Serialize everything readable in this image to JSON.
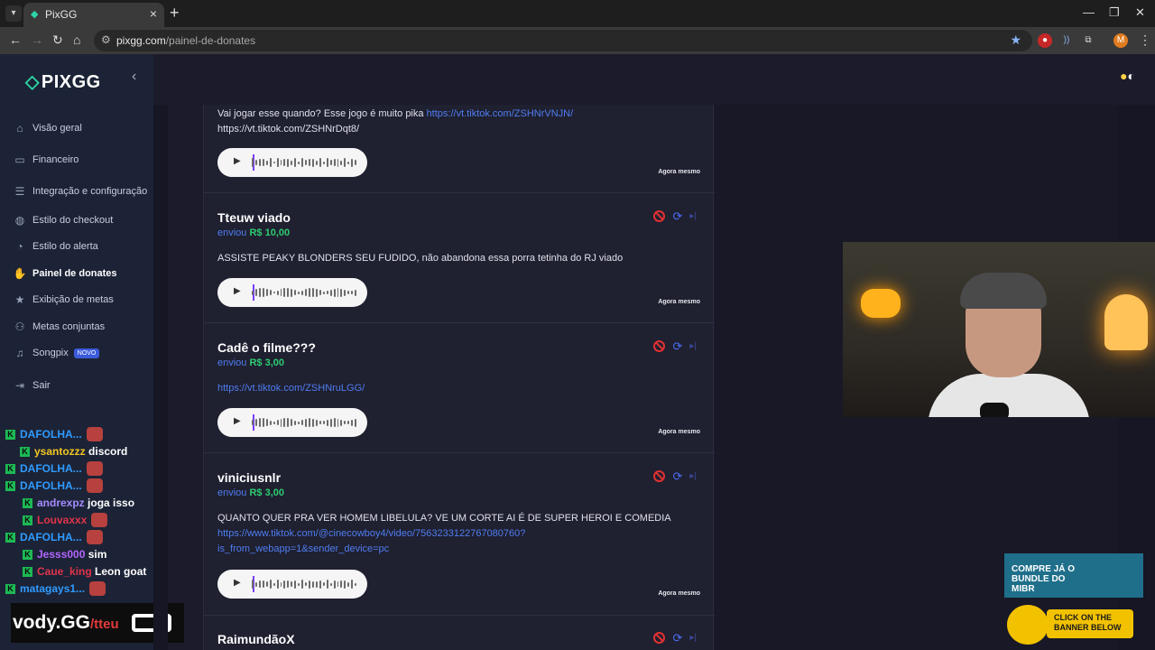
{
  "browser": {
    "tab_title": "PixGG",
    "url_host": "pixgg.com",
    "url_path": "/painel-de-donates",
    "profile_initial": "M"
  },
  "sidebar": {
    "logo": "PIXGG",
    "items": [
      {
        "label": "Visão geral",
        "icon": "home-icon"
      },
      {
        "label": "Financeiro",
        "icon": "wallet-icon"
      },
      {
        "label": "Integração e configuração",
        "icon": "settings-icon"
      },
      {
        "label": "Estilo do checkout",
        "icon": "palette-icon"
      },
      {
        "label": "Estilo do alerta",
        "icon": "alert-icon"
      },
      {
        "label": "Painel de donates",
        "icon": "donation-icon"
      },
      {
        "label": "Exibição de metas",
        "icon": "star-icon"
      },
      {
        "label": "Metas conjuntas",
        "icon": "group-icon"
      },
      {
        "label": "Songpix",
        "icon": "music-icon",
        "badge": "NOVO"
      },
      {
        "label": "Sair",
        "icon": "logout-icon"
      }
    ],
    "active_index": 5
  },
  "chat": [
    {
      "user": "DAFOLHA...",
      "color": "#2f9bff",
      "text": ""
    },
    {
      "user": "ysantozzz",
      "color": "#f3c623",
      "text": "discord"
    },
    {
      "user": "DAFOLHA...",
      "color": "#2f9bff",
      "text": ""
    },
    {
      "user": "DAFOLHA...",
      "color": "#2f9bff",
      "text": ""
    },
    {
      "user": "andrexpz",
      "color": "#a48bff",
      "text": "joga isso"
    },
    {
      "user": "Louvaxxx",
      "color": "#e0344a",
      "text": ""
    },
    {
      "user": "DAFOLHA...",
      "color": "#2f9bff",
      "text": ""
    },
    {
      "user": "Jesss000",
      "color": "#b266ff",
      "text": "sim"
    },
    {
      "user": "Caue_king",
      "color": "#e0344a",
      "text": "Leon goat"
    },
    {
      "user": "matagays1...",
      "color": "#2f9bff",
      "text": ""
    }
  ],
  "overlay": {
    "vody_brand": "vody.GG",
    "vody_handle": "/tteu"
  },
  "donations": [
    {
      "name": "",
      "sent_label": "",
      "amount": "",
      "message": "Vai jogar esse quando? Esse jogo é muito pika ",
      "link": "https://vt.tiktok.com/ZSHNrVNJN/",
      "message2": "https://vt.tiktok.com/ZSHNrDqt8/",
      "time": "Agora mesmo"
    },
    {
      "name": "Tteuw viado",
      "sent_label": "enviou",
      "amount": "R$ 10,00",
      "message": "ASSISTE PEAKY BLONDERS SEU FUDIDO, não abandona essa porra tetinha do RJ viado",
      "time": "Agora mesmo"
    },
    {
      "name": "Cadê o filme???",
      "sent_label": "enviou",
      "amount": "R$ 3,00",
      "link": "https://vt.tiktok.com/ZSHNruLGG/",
      "time": "Agora mesmo"
    },
    {
      "name": "viniciusnlr",
      "sent_label": "enviou",
      "amount": "R$ 3,00",
      "message": "QUANTO QUER PRA VER HOMEM LIBELULA? VE UM CORTE AI É DE SUPER HEROI E COMEDIA",
      "link": "https://www.tiktok.com/@cinecowboy4/video/7563233122767080760?",
      "link2": "is_from_webapp=1&sender_device=pc",
      "time": "Agora mesmo"
    },
    {
      "name": "RaimundãoX"
    }
  ],
  "ads": {
    "ad1": "COMPRE JÁ O BUNDLE DO MIBR",
    "ad2": "CLICK ON THE BANNER BELOW"
  }
}
